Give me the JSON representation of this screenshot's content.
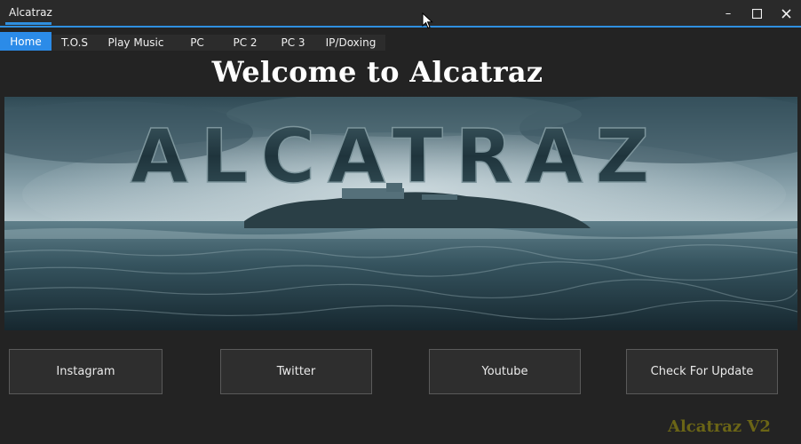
{
  "window": {
    "title": "Alcatraz",
    "controls": {
      "minimize": "–",
      "maximize": "☐",
      "close": "✕"
    }
  },
  "tabs": [
    {
      "label": "Home",
      "active": true
    },
    {
      "label": "T.O.S",
      "active": false
    },
    {
      "label": "Play Music",
      "active": false
    },
    {
      "label": "PC",
      "active": false
    },
    {
      "label": "PC 2",
      "active": false
    },
    {
      "label": "PC 3",
      "active": false
    },
    {
      "label": "IP/Doxing",
      "active": false
    }
  ],
  "main": {
    "heading": "Welcome to Alcatraz",
    "banner_text": "ALCATRAZ",
    "buttons": [
      {
        "label": "Instagram"
      },
      {
        "label": "Twitter"
      },
      {
        "label": "Youtube"
      },
      {
        "label": "Check For Update"
      }
    ],
    "footer_brand": "Alcatraz V2"
  },
  "colors": {
    "accent": "#2b8be8",
    "background": "#232323",
    "brand_text": "#6b6516"
  }
}
